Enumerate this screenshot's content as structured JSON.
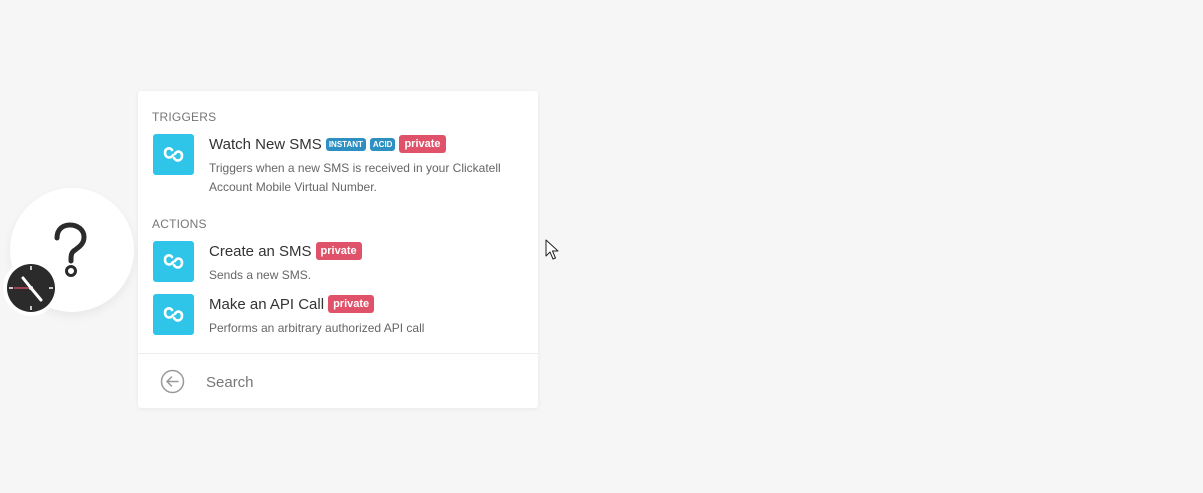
{
  "triggers": {
    "title": "TRIGGERS",
    "items": [
      {
        "title": "Watch New SMS",
        "badges": [
          "INSTANT",
          "ACID",
          "private"
        ],
        "description": "Triggers when a new SMS is received in your Clickatell Account Mobile Virtual Number."
      }
    ]
  },
  "actions": {
    "title": "ACTIONS",
    "items": [
      {
        "title": "Create an SMS",
        "badges": [
          "private"
        ],
        "description": "Sends a new SMS."
      },
      {
        "title": "Make an API Call",
        "badges": [
          "private"
        ],
        "description": "Performs an arbitrary authorized API call"
      }
    ]
  },
  "search": {
    "placeholder": "Search",
    "value": ""
  },
  "icons": {
    "module": "question-mark-icon",
    "schedule": "clock-icon",
    "app": "clickatell-link-icon",
    "back": "back-arrow-icon",
    "pointer": "mouse-cursor-icon"
  },
  "colors": {
    "app_icon": "#2ec5e8",
    "badge_instant": "#2d8fc2",
    "badge_private": "#e0516a",
    "background": "#f6f6f7"
  }
}
